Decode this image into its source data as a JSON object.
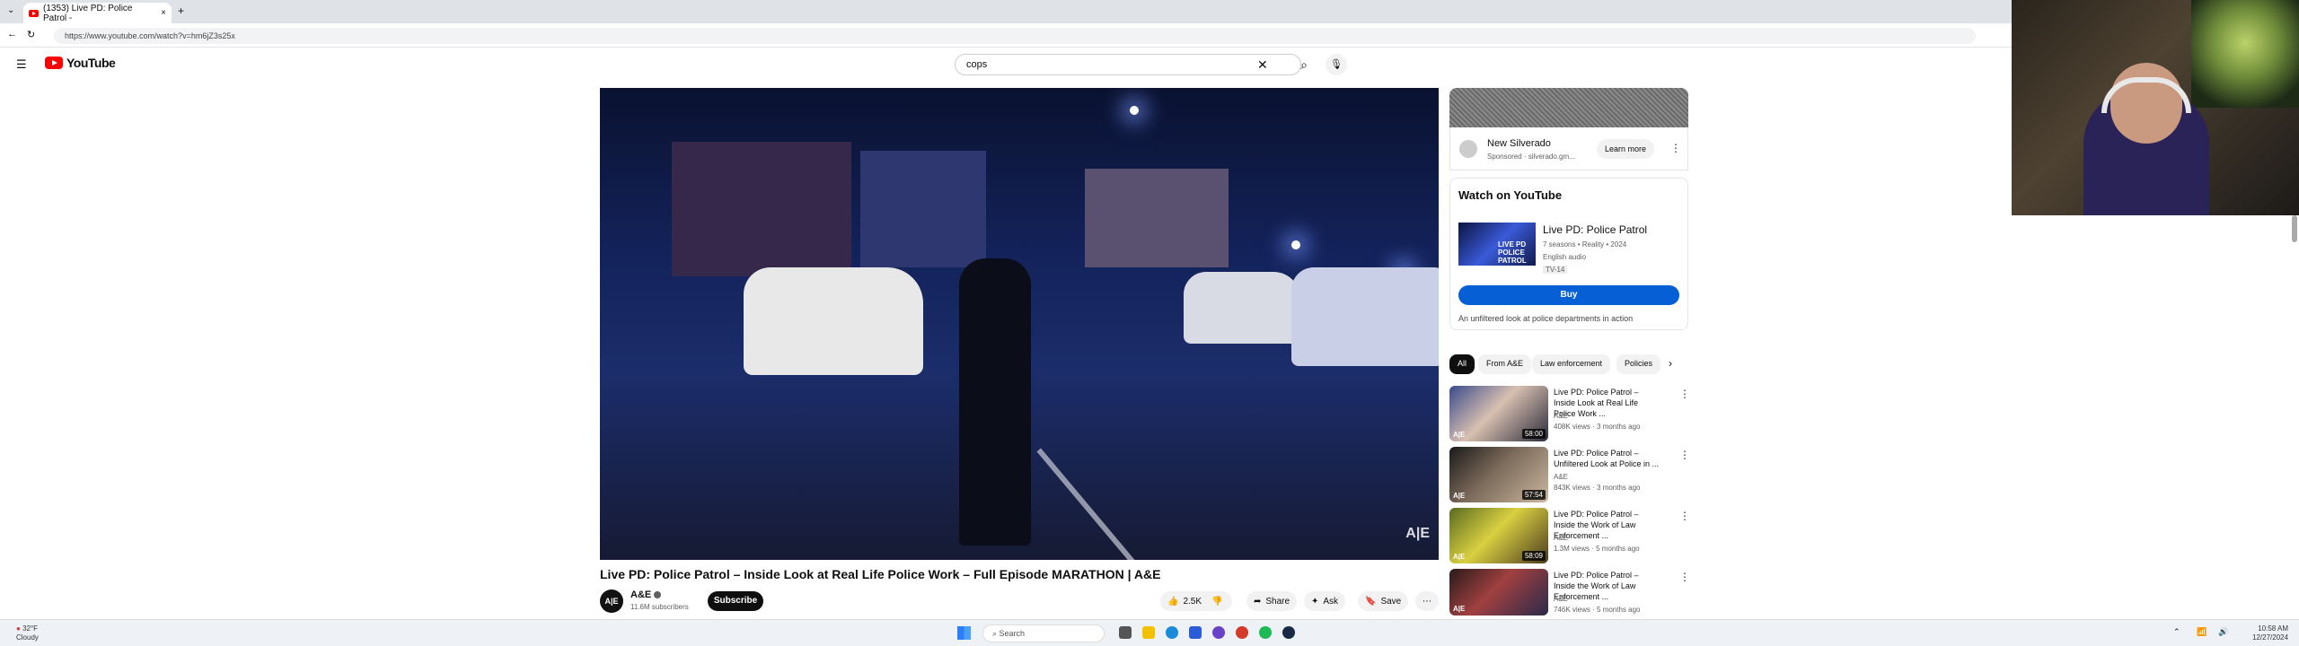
{
  "browser": {
    "tab_title": "(1353) Live PD: Police Patrol -",
    "tab_close": "×",
    "new_tab": "+",
    "url": "https://www.youtube.com/watch?v=hm6jZ3s25x"
  },
  "header": {
    "brand": "YouTube",
    "search_value": "cops",
    "clear": "✕",
    "search_icon": "⌕",
    "mic_icon": "🎙"
  },
  "video": {
    "watermark": "A|E",
    "title": "Live PD: Police Patrol – Inside Look at Real Life Police Work – Full Episode MARATHON | A&E",
    "channel": "A&E",
    "channel_avatar": "A|E",
    "subscribers": "11.6M subscribers",
    "subscribe": "Subscribe",
    "likes": "2.5K",
    "share": "Share",
    "ask": "Ask",
    "save": "Save",
    "more": "⋯"
  },
  "ad": {
    "name": "New Silverado",
    "sponsored": "Sponsored · silverado.gm...",
    "learn_more": "Learn more"
  },
  "watch_on_youtube": {
    "heading": "Watch on YouTube",
    "show_title": "Live PD: Police Patrol",
    "thumb_text": "LIVE PD POLICE PATROL",
    "meta1": "7 seasons • Reality • 2024",
    "meta2": "English audio",
    "rating": "TV-14",
    "buy": "Buy",
    "description": "An unfiltered look at police departments in action"
  },
  "chips": [
    "All",
    "From A&E",
    "Law enforcement",
    "Policies"
  ],
  "recommendations": [
    {
      "title": "Live PD: Police Patrol – Inside Look at Real Life Police Work ...",
      "channel": "A&E",
      "meta": "408K views · 3 months ago",
      "duration": "58:00",
      "ae": "A|E"
    },
    {
      "title": "Live PD: Police Patrol – Unfiltered Look at Police in ...",
      "channel": "A&E",
      "meta": "843K views · 3 months ago",
      "duration": "57:54",
      "ae": "A|E"
    },
    {
      "title": "Live PD: Police Patrol – Inside the Work of Law Enforcement ...",
      "channel": "A&E",
      "meta": "1.3M views · 5 months ago",
      "duration": "58:09",
      "ae": "A|E"
    },
    {
      "title": "Live PD: Police Patrol – Inside the Work of Law Enforcement ...",
      "channel": "A&E",
      "meta": "746K views · 5 months ago",
      "duration": "",
      "ae": "A|E"
    }
  ],
  "taskbar": {
    "temp": "32°F",
    "condition": "Cloudy",
    "search": "Search",
    "time": "10:58 AM",
    "date": "12/27/2024"
  }
}
